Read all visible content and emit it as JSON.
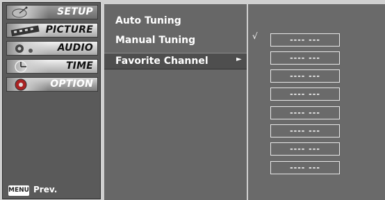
{
  "categories": [
    {
      "label": "SETUP",
      "icon": "satellite-dish-icon"
    },
    {
      "label": "PICTURE",
      "icon": "filmstrip-icon"
    },
    {
      "label": "AUDIO",
      "icon": "speaker-icon"
    },
    {
      "label": "TIME",
      "icon": "clock-icon"
    },
    {
      "label": "OPTION",
      "icon": "option-icon"
    }
  ],
  "footer": {
    "menu_key": "MENU",
    "prev_label": "Prev."
  },
  "submenu": {
    "items": [
      "Auto Tuning",
      "Manual Tuning",
      "Favorite Channel"
    ],
    "selected_arrow": "►"
  },
  "favorites": {
    "checkmark": "√",
    "slots": [
      "---- ---",
      "---- ---",
      "---- ---",
      "---- ---",
      "---- ---",
      "---- ---",
      "---- ---",
      "---- ---"
    ]
  }
}
